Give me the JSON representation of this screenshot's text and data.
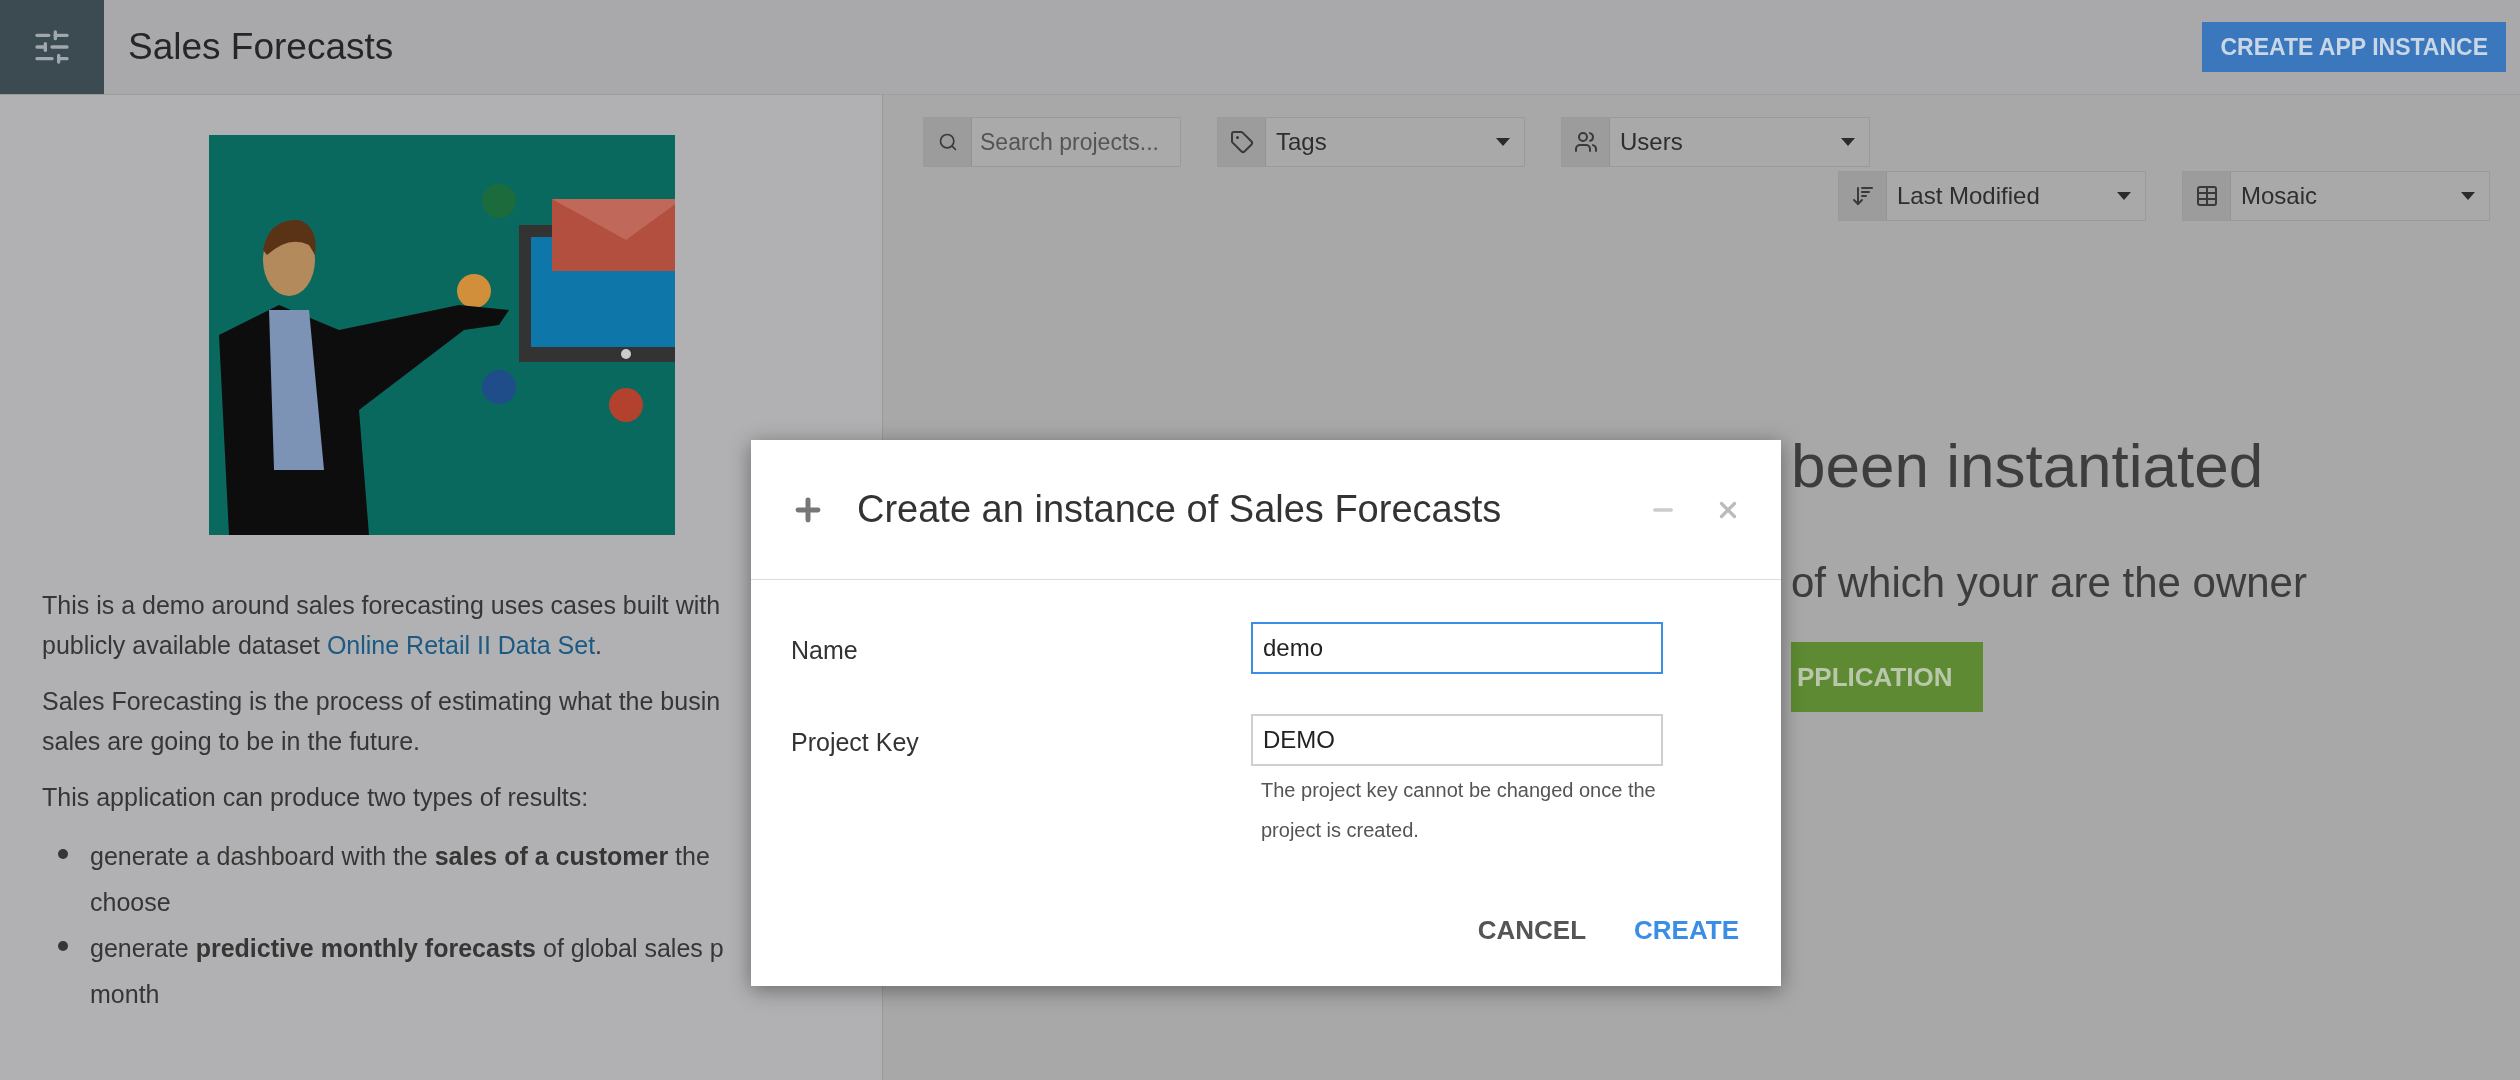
{
  "app": {
    "title": "Sales Forecasts",
    "create_button": "CREATE APP INSTANCE"
  },
  "description": {
    "paragraphs": [
      {
        "lines": [
          "This is a demo around sales forecasting uses cases built with",
          {
            "before": "publicly available dataset ",
            "link": "Online Retail II Data Set",
            "after": "."
          }
        ]
      },
      {
        "lines": [
          "Sales Forecasting is the process of estimating what the busin",
          "sales are going to be in the future."
        ]
      },
      {
        "lines": [
          "This application can produce two types of results:"
        ]
      }
    ],
    "bullets": [
      {
        "lines": [
          "generate a dashboard with the **sales of a customer** the",
          "choose"
        ]
      },
      {
        "lines": [
          "generate **predictive monthly forecasts** of global sales p",
          "month"
        ]
      }
    ]
  },
  "filters": {
    "search": {
      "placeholder": "Search projects..."
    },
    "tags": "Tags",
    "users": "Users",
    "sort": "Last Modified",
    "view": "Mosaic"
  },
  "empty_state": {
    "title": "been instantiated",
    "subtitle": "of which your are the owner",
    "button": "PPLICATION"
  },
  "dialog": {
    "title": "Create an instance of Sales Forecasts",
    "fields": [
      {
        "label": "Name",
        "value": "demo",
        "focused": true
      },
      {
        "label": "Project Key",
        "value": "DEMO",
        "focused": false,
        "help": "The project key cannot be changed once the project is created."
      }
    ],
    "buttons": [
      {
        "label": "CANCEL",
        "primary": false
      },
      {
        "label": "CREATE",
        "primary": true
      }
    ]
  }
}
